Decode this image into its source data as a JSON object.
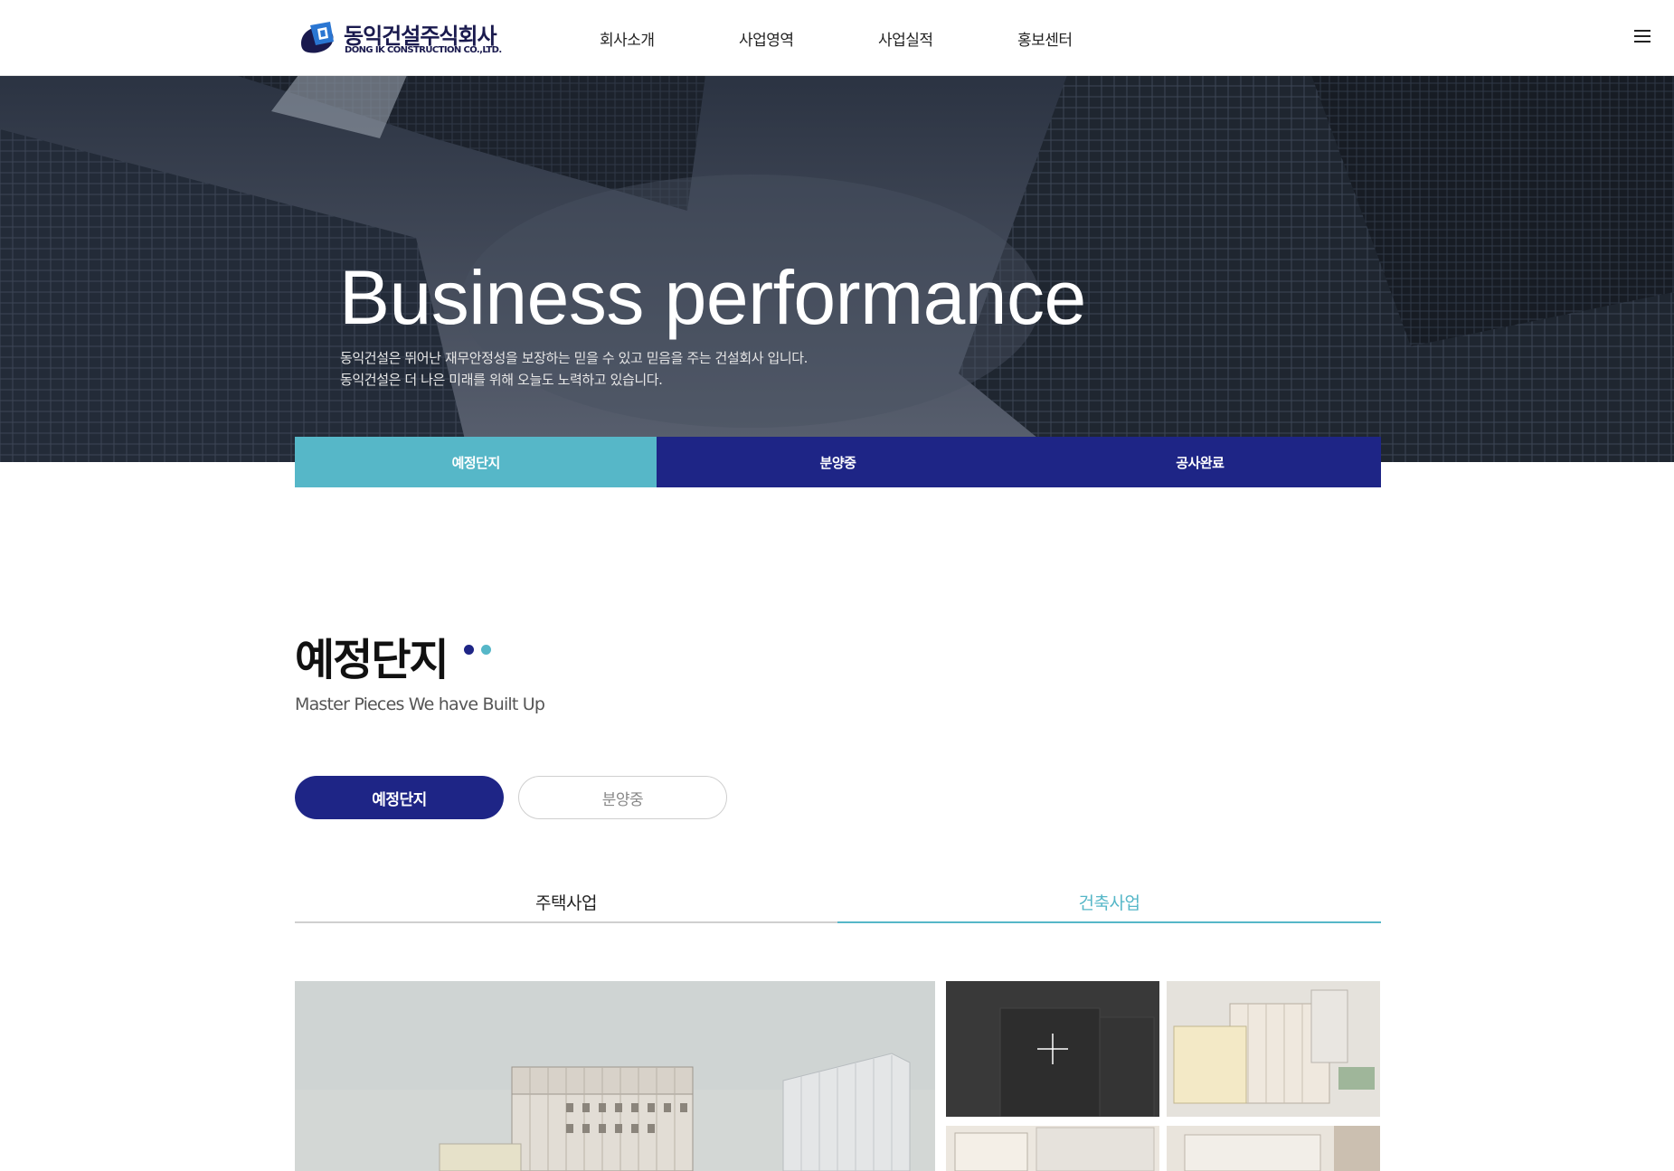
{
  "header": {
    "logo": {
      "name_ko": "동익건설주식회사",
      "name_en": "DONG IK CONSTRUCTION CO.,LTD.",
      "colors": {
        "navy": "#1a1a4e",
        "blue": "#1a4fb0"
      }
    },
    "nav": [
      "회사소개",
      "사업영역",
      "사업실적",
      "홍보센터"
    ],
    "menu_icon": "hamburger-icon"
  },
  "hero": {
    "title": "Business performance",
    "desc_line1": "동익건설은 뛰어난 재무안정성을 보장하는 믿을 수 있고 믿음을 주는 건설회사 입니다.",
    "desc_line2": "동익건설은 더 나은 미래를 위해 오늘도 노력하고 있습니다."
  },
  "big_tabs": [
    {
      "label": "예정단지",
      "active": true
    },
    {
      "label": "분양중",
      "active": false
    },
    {
      "label": "공사완료",
      "active": false
    }
  ],
  "section": {
    "title": "예정단지",
    "subtitle": "Master Pieces We have Built Up"
  },
  "filters": [
    {
      "label": "예정단지",
      "active": true
    },
    {
      "label": "분양중",
      "active": false
    }
  ],
  "sub_tabs": [
    {
      "label": "주택사업",
      "active": false
    },
    {
      "label": "건축사업",
      "active": true
    }
  ],
  "gallery": {
    "plus_icon": "plus-icon"
  },
  "colors": {
    "navy": "#1e2586",
    "teal": "#56b7c8"
  }
}
